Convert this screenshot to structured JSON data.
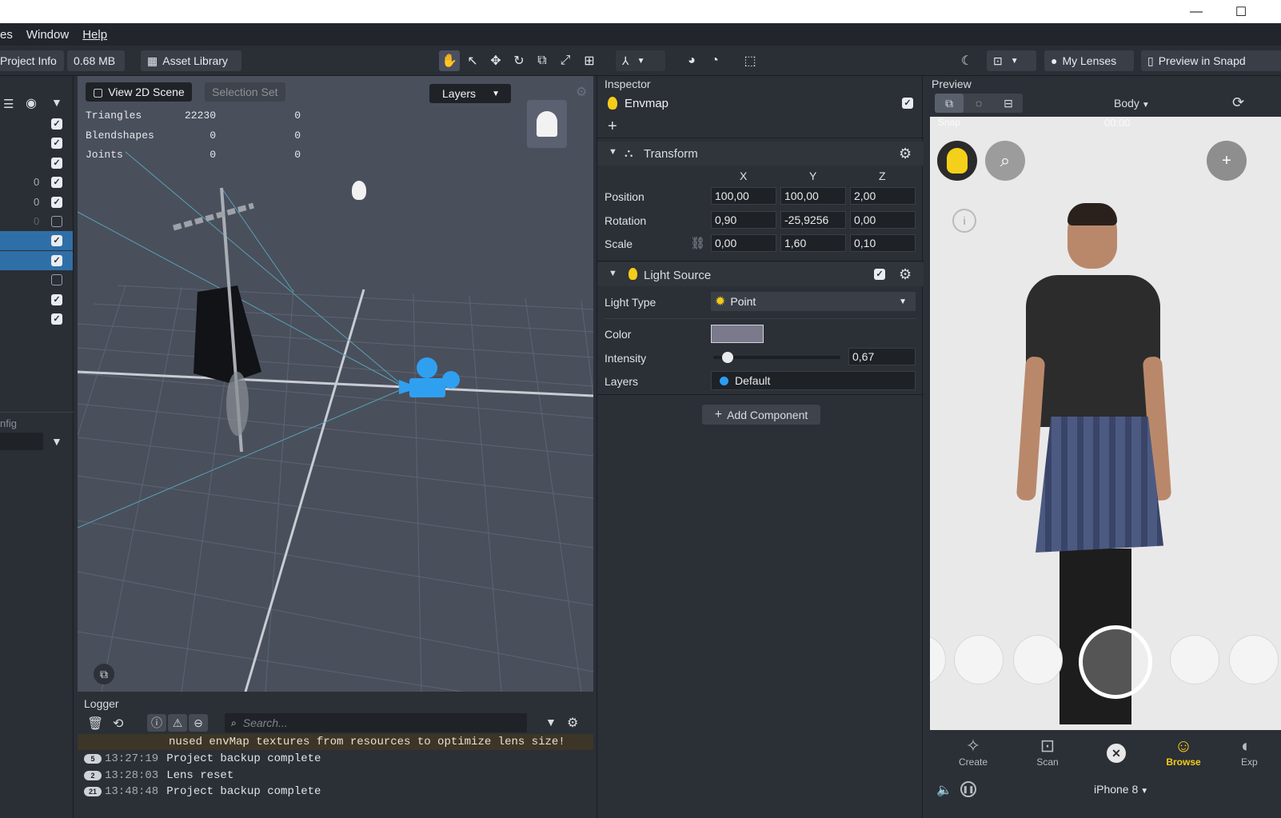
{
  "menu": {
    "items": [
      "es",
      "Window",
      "Help"
    ]
  },
  "toolbar": {
    "project_info": "Project Info",
    "size": "0.68 MB",
    "asset_library": "Asset Library",
    "my_lenses": "My Lenses",
    "preview_in_snap": "Preview in Snapd"
  },
  "hierarchy": {
    "rows": [
      {
        "num": "",
        "checked": true,
        "selected": false
      },
      {
        "num": "",
        "checked": true,
        "selected": false
      },
      {
        "num": "",
        "checked": true,
        "selected": false
      },
      {
        "num": "0",
        "checked": true,
        "selected": false
      },
      {
        "num": "0",
        "checked": true,
        "selected": false
      },
      {
        "num": "0",
        "checked": false,
        "selected": false
      },
      {
        "num": "",
        "checked": true,
        "selected": true
      },
      {
        "num": "",
        "checked": true,
        "selected": true
      },
      {
        "num": "",
        "checked": false,
        "selected": false
      },
      {
        "num": "",
        "checked": true,
        "selected": false
      },
      {
        "num": "",
        "checked": true,
        "selected": false
      }
    ],
    "lower_label": "nfig"
  },
  "viewport": {
    "view_2d": "View 2D Scene",
    "selection_set": "Selection Set",
    "layers": "Layers",
    "stats": [
      {
        "label": "Triangles",
        "a": "22230",
        "b": "0"
      },
      {
        "label": "Blendshapes",
        "a": "0",
        "b": "0"
      },
      {
        "label": "Joints",
        "a": "0",
        "b": "0"
      }
    ]
  },
  "logger": {
    "title": "Logger",
    "search_placeholder": "Search...",
    "warning": "nused envMap textures from resources to optimize lens size!",
    "rows": [
      {
        "badge": "5",
        "time": "13:27:19",
        "msg": "Project backup complete"
      },
      {
        "badge": "2",
        "time": "13:28:03",
        "msg": "Lens reset"
      },
      {
        "badge": "21",
        "time": "13:48:48",
        "msg": "Project backup complete"
      }
    ]
  },
  "inspector": {
    "title": "Inspector",
    "object_name": "Envmap",
    "transform": {
      "title": "Transform",
      "headers": [
        "X",
        "Y",
        "Z"
      ],
      "rows": [
        {
          "label": "Position",
          "x": "100,00",
          "y": "100,00",
          "z": "2,00"
        },
        {
          "label": "Rotation",
          "x": "0,90",
          "y": "-25,9256",
          "z": "0,00"
        },
        {
          "label": "Scale",
          "x": "0,00",
          "y": "1,60",
          "z": "0,10"
        }
      ]
    },
    "light": {
      "title": "Light Source",
      "type_label": "Light Type",
      "type_value": "Point",
      "color_label": "Color",
      "color_value": "#7a7a8c",
      "intensity_label": "Intensity",
      "intensity_value": "0,67",
      "intensity_fraction": 0.067,
      "layers_label": "Layers",
      "layers_value": "Default"
    },
    "add_component": "Add Component"
  },
  "preview": {
    "title": "Preview",
    "body": "Body",
    "status_carrier": "Snap",
    "status_time": "00:00",
    "nav": [
      "Create",
      "Scan",
      "Browse",
      "Exp"
    ],
    "device": "iPhone 8"
  },
  "colors": {
    "accent_blue": "#2a9df4",
    "bulb": "#f5cc1a",
    "selected_row": "#2f6fa8"
  }
}
